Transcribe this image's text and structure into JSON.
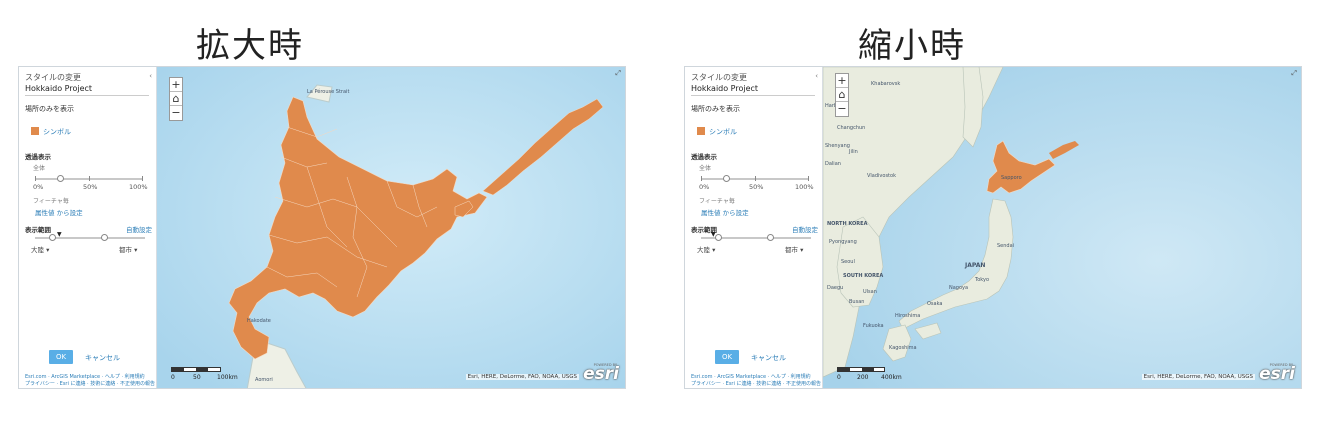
{
  "headings": {
    "zoomed_in": "拡大時",
    "zoomed_out": "縮小時"
  },
  "colors": {
    "accent": "#e08a4c",
    "link": "#2e7fb8",
    "water": "#bde0f0",
    "land": "#eef0e6",
    "ok_button": "#59aee6"
  },
  "panel": {
    "title": "スタイルの変更",
    "project": "Hokkaido Project",
    "show_location": "場所のみを表示",
    "symbol": "シンボル",
    "transparency": "透過表示",
    "all": "全体",
    "pct_0": "0%",
    "pct_50": "50%",
    "pct_100": "100%",
    "feature": "フィーチャ毎",
    "set_from_attr": "属性値 から設定",
    "visible_range": "表示範囲",
    "current_view": "自動設定",
    "range_min": "大陸",
    "range_max": "都市",
    "ok": "OK",
    "cancel": "キャンセル",
    "footer_line1": "Esri.com · ArcGIS Marketplace · ヘルプ · 利用規約",
    "footer_line2": "プライバシー · Esri に連絡 · 技術に連絡 · 不正使用の報告"
  },
  "map": {
    "attribution": "Esri, HERE, DeLorme, FAO, NOAA, USGS",
    "logo": "esri",
    "powered_by": "POWERED BY",
    "zoom_in": "+",
    "zoom_out": "−",
    "home_icon": "⌂",
    "expand_icon": "⤢",
    "scale_left": [
      "0",
      "50",
      "100km"
    ],
    "scale_right": [
      "0",
      "200",
      "400km"
    ],
    "left_labels": {
      "sea": "La Pérouse Strait",
      "pl1": "Hakodate",
      "pl2": "Aomori"
    },
    "right_labels": [
      "Khabarovsk",
      "Harbin",
      "Changchun",
      "Shenyang",
      "Dalian",
      "Vladivostok",
      "NORTH KOREA",
      "Pyongyang",
      "Seoul",
      "SOUTH KOREA",
      "Busan",
      "Fukuoka",
      "Daegu",
      "Osaka",
      "Nagoya",
      "Tokyo",
      "Sendai",
      "JAPAN",
      "Hiroshima",
      "Sapporo",
      "Jilin",
      "Ulsan",
      "Kagoshima"
    ]
  }
}
